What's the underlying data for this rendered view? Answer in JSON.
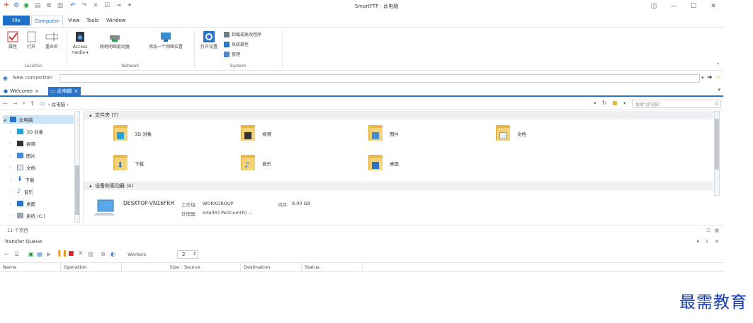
{
  "window": {
    "title": "SmartFTP - 此电脑"
  },
  "menu": {
    "items": [
      "File",
      "Computer",
      "View",
      "Tools",
      "Window"
    ]
  },
  "ribbon": {
    "location": {
      "label": "Location",
      "buttons": [
        "属性",
        "打开",
        "重命名"
      ]
    },
    "network": {
      "label": "Network",
      "buttons": [
        "Access media ▾",
        "映射网络驱动器",
        "添加一个网络位置"
      ]
    },
    "system": {
      "label": "System",
      "open_settings": "打开设置",
      "items": [
        "卸载或更改程序",
        "系统属性",
        "管理"
      ]
    }
  },
  "connection": {
    "label": "New connection",
    "value": ""
  },
  "tabs": [
    {
      "label": "Welcome"
    },
    {
      "label": "此电脑"
    }
  ],
  "address": {
    "path": "此电脑",
    "search_placeholder": "搜索\"此电脑\""
  },
  "tree": {
    "root": "此电脑",
    "items": [
      "3D 对象",
      "视频",
      "图片",
      "文档",
      "下载",
      "音乐",
      "桌面",
      "系统 (C:)"
    ]
  },
  "content": {
    "folders_header": "文件夹 (7)",
    "folders": [
      "3D 对象",
      "视频",
      "图片",
      "文档",
      "下载",
      "音乐",
      "桌面"
    ],
    "devices_header": "设备和驱动器 (4)",
    "device": {
      "name": "DESKTOP-VN16FKH",
      "workgroup_label": "工作组:",
      "workgroup": "WORKGROUP",
      "memory_label": "内存:",
      "memory": "8.00 GB",
      "processor_label": "处理器:",
      "processor": "Intel(R) Pentium(R) ..."
    }
  },
  "status": {
    "items_count": "11 个项目"
  },
  "transfer_queue": {
    "title": "Transfer Queue",
    "workers_label": "Workers",
    "workers_value": "2",
    "columns": [
      "Name",
      "Operation",
      "Size",
      "Source",
      "Destination",
      "Status"
    ]
  },
  "watermark": "最需教育",
  "colors": {
    "accent": "#1e6fc8",
    "folder": "#e8b94a",
    "watermark": "#1a3fa8"
  }
}
